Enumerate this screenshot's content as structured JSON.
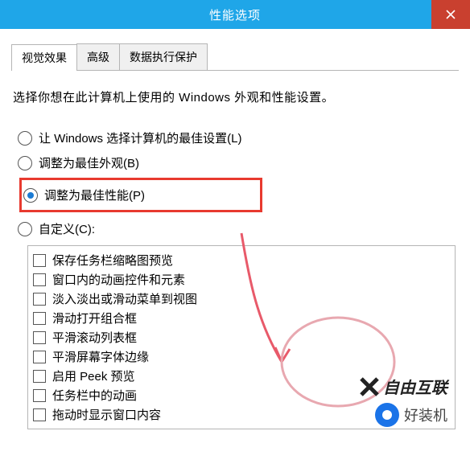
{
  "window": {
    "title": "性能选项"
  },
  "tabs": {
    "visual": "视觉效果",
    "advanced": "高级",
    "dep": "数据执行保护"
  },
  "instruction": "选择你想在此计算机上使用的 Windows 外观和性能设置。",
  "radio": {
    "auto": "让 Windows 选择计算机的最佳设置(L)",
    "best_appearance": "调整为最佳外观(B)",
    "best_performance": "调整为最佳性能(P)",
    "custom": "自定义(C):"
  },
  "radio_selected": "best_performance",
  "checks": [
    "保存任务栏缩略图预览",
    "窗口内的动画控件和元素",
    "淡入淡出或滑动菜单到视图",
    "滑动打开组合框",
    "平滑滚动列表框",
    "平滑屏幕字体边缘",
    "启用 Peek 预览",
    "任务栏中的动画",
    "拖动时显示窗口内容"
  ],
  "watermark1": "自由互联",
  "watermark2": "好装机"
}
